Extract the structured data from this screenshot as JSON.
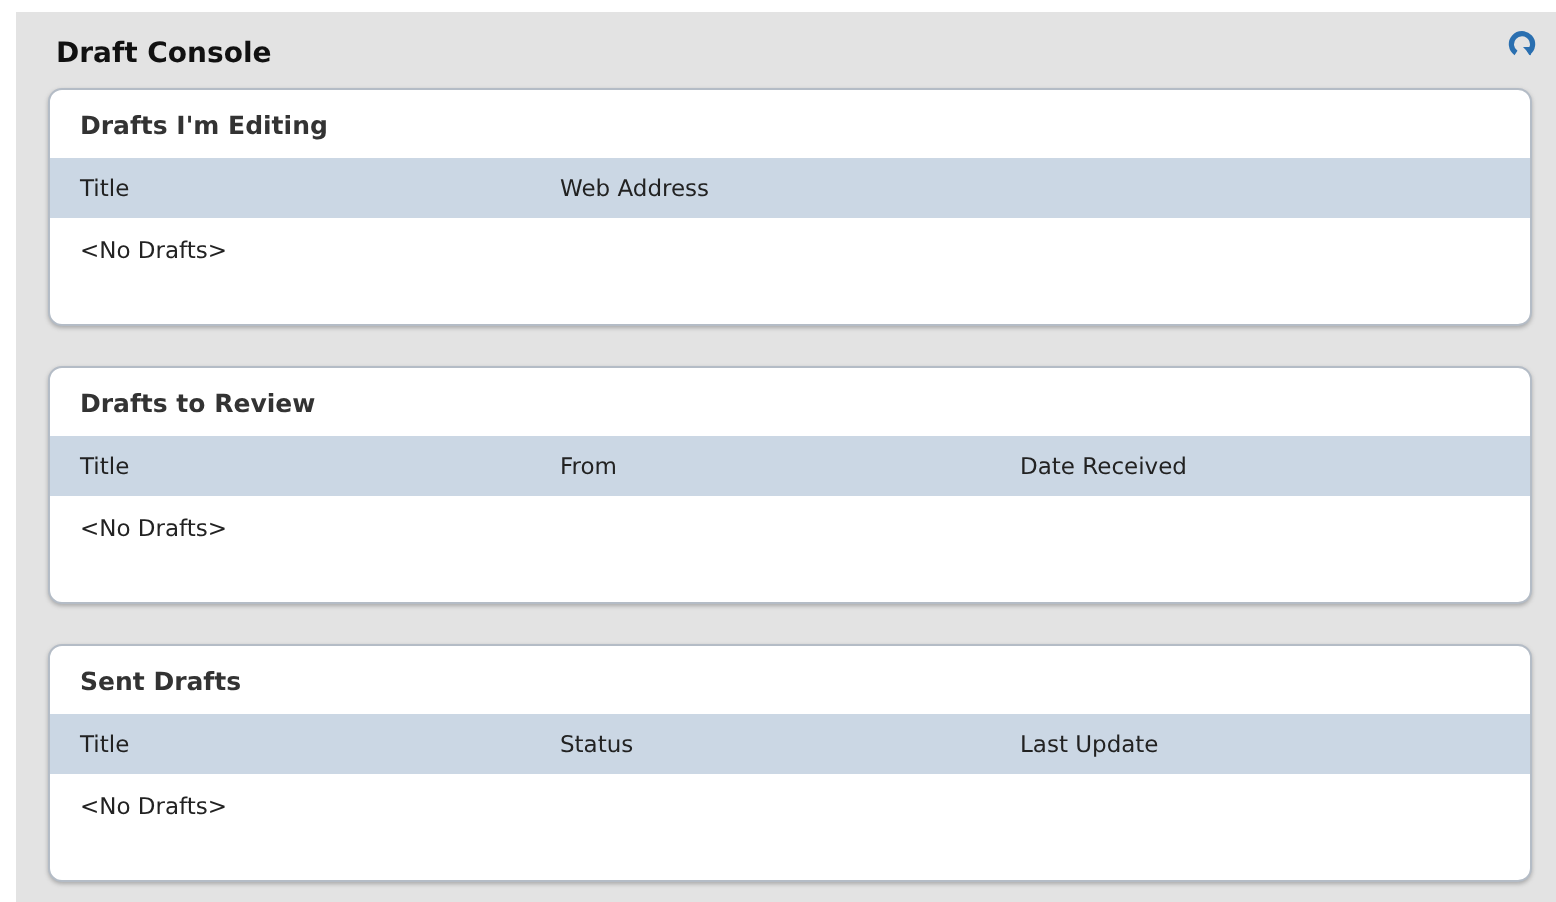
{
  "console": {
    "title": "Draft Console"
  },
  "panels": [
    {
      "title": "Drafts I'm Editing",
      "columns": [
        "Title",
        "Web Address"
      ],
      "empty_text": "<No Drafts>"
    },
    {
      "title": "Drafts to Review",
      "columns": [
        "Title",
        "From",
        "Date Received"
      ],
      "empty_text": "<No Drafts>"
    },
    {
      "title": "Sent Drafts",
      "columns": [
        "Title",
        "Status",
        "Last Update"
      ],
      "empty_text": "<No Drafts>"
    }
  ]
}
